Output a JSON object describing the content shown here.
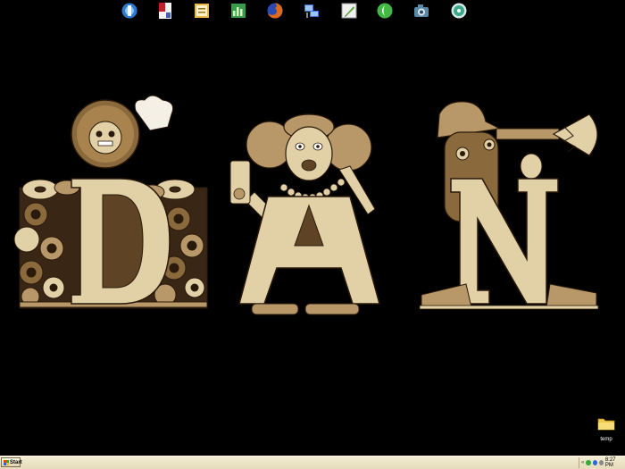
{
  "quick_launch": [
    {
      "name": "internet-explorer-icon",
      "color": "#2a7bd4"
    },
    {
      "name": "pdf-reader-icon",
      "color": "#c0202a"
    },
    {
      "name": "notes-icon",
      "color": "#e8b84a"
    },
    {
      "name": "spreadsheet-icon",
      "color": "#3a9a4a"
    },
    {
      "name": "firefox-icon",
      "color": "#e06a1a"
    },
    {
      "name": "network-connections-icon",
      "color": "#3c70c8"
    },
    {
      "name": "editor-icon",
      "color": "#5aa838"
    },
    {
      "name": "media-player-icon",
      "color": "#44b844"
    },
    {
      "name": "camera-icon",
      "color": "#5a8aa8"
    },
    {
      "name": "cd-burner-icon",
      "color": "#3aa88a"
    }
  ],
  "wallpaper": {
    "letters": [
      "D",
      "A",
      "N"
    ],
    "colors": {
      "light": "#e2d0a6",
      "mid": "#b89868",
      "dark": "#5e4424",
      "line": "#2a1a0c"
    }
  },
  "desktop_items": [
    {
      "label": "temp",
      "icon": "folder-icon"
    }
  ],
  "taskbar": {
    "start_label": "Start",
    "tray_chevron": "«",
    "clock": "8:27 PM"
  }
}
